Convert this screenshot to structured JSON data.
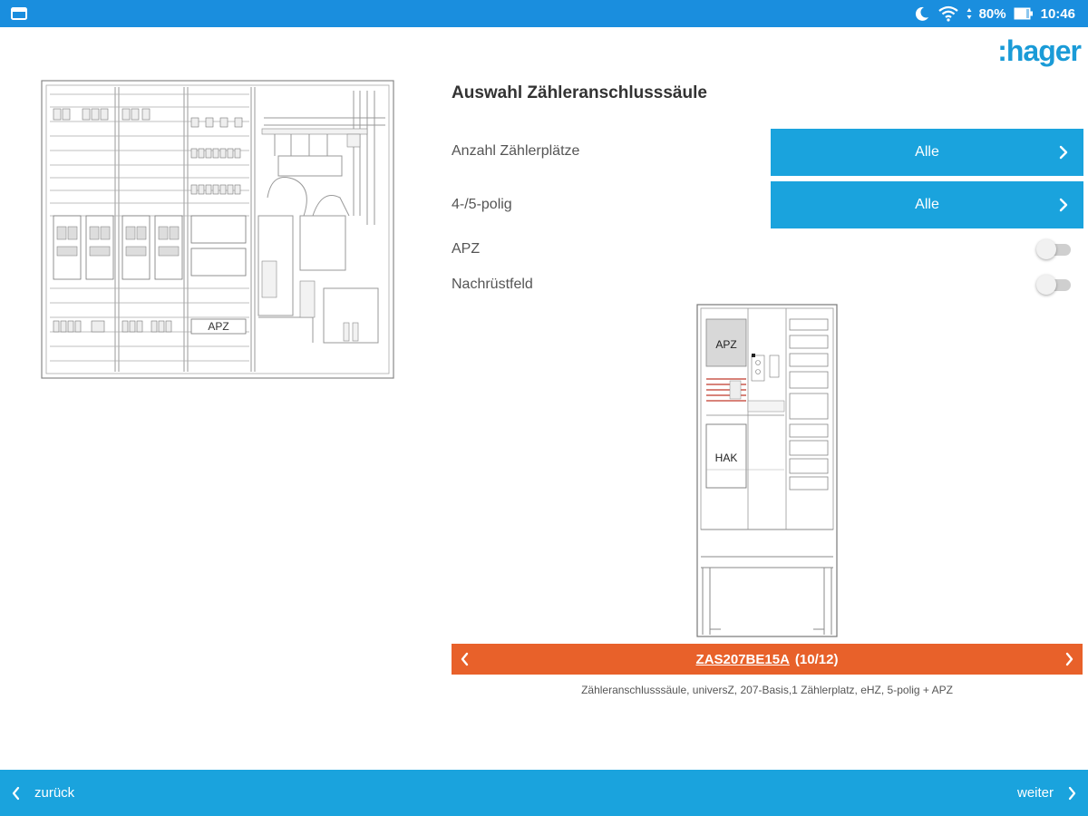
{
  "status_bar": {
    "battery": "80%",
    "time": "10:46"
  },
  "logo": ":hager",
  "left_drawing": {
    "label": "APZ"
  },
  "page_title": "Auswahl Zähleranschlusssäule",
  "options": {
    "meter_places": {
      "label": "Anzahl Zählerplätze",
      "value": "Alle"
    },
    "poles": {
      "label": "4-/5-polig",
      "value": "Alle"
    },
    "apz": {
      "label": "APZ",
      "enabled": false
    },
    "retrofit": {
      "label": "Nachrüstfeld",
      "enabled": false
    }
  },
  "product_drawing": {
    "apz_label": "APZ",
    "hak_label": "HAK"
  },
  "product": {
    "code": "ZAS207BE15A",
    "counter": "(10/12)",
    "description": "Zähleranschlusssäule, universZ, 207-Basis,1 Zählerplatz, eHZ, 5-polig + APZ"
  },
  "navigation": {
    "back": "zurück",
    "next": "weiter"
  },
  "colors": {
    "status_bar": "#1a8ede",
    "accent_blue": "#1aa3dd",
    "product_bar": "#e8612a",
    "logo": "#1a9bd7"
  }
}
